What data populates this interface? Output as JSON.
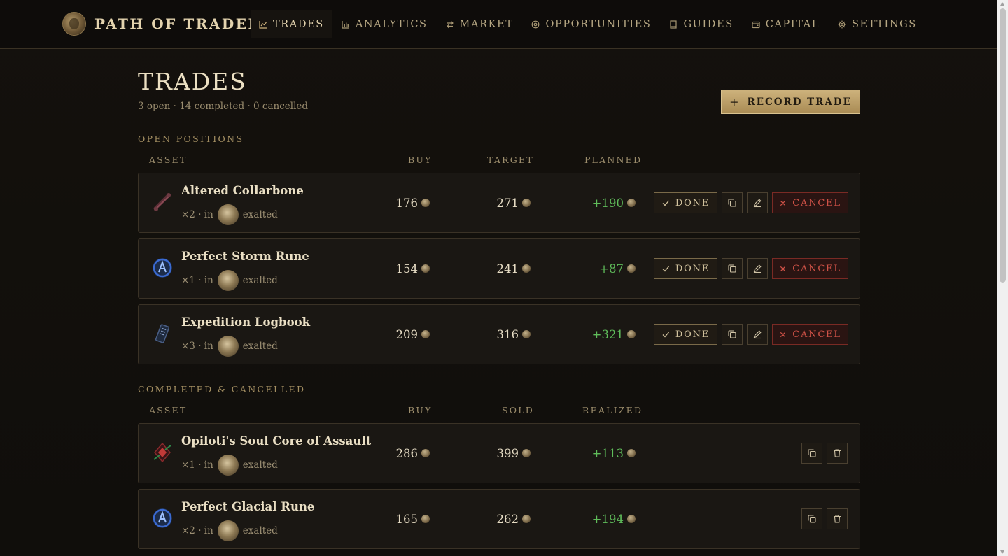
{
  "nav": {
    "brand": "PATH OF TRADER",
    "items": [
      {
        "label": "TRADES",
        "icon": "chart-line-icon",
        "active": true
      },
      {
        "label": "ANALYTICS",
        "icon": "bar-chart-icon"
      },
      {
        "label": "MARKET",
        "icon": "arrows-exchange-icon"
      },
      {
        "label": "OPPORTUNITIES",
        "icon": "target-icon"
      },
      {
        "label": "GUIDES",
        "icon": "book-icon"
      },
      {
        "label": "CAPITAL",
        "icon": "wallet-icon"
      },
      {
        "label": "SETTINGS",
        "icon": "gear-icon"
      }
    ]
  },
  "header": {
    "title": "TRADES",
    "summary": "3 open · 14 completed · 0 cancelled",
    "record_label": "RECORD TRADE",
    "record_icon": "+"
  },
  "open": {
    "section_label": "OPEN POSITIONS",
    "columns": {
      "asset": "ASSET",
      "buy": "BUY",
      "target": "TARGET",
      "planned": "PLANNED"
    },
    "done_label": "DONE",
    "cancel_label": "CANCEL",
    "rows": [
      {
        "name": "Altered Collarbone",
        "qty": "×2 · in",
        "currency": "exalted",
        "buy": "176",
        "target": "271",
        "planned": "+190",
        "icon": "bone-icon"
      },
      {
        "name": "Perfect Storm Rune",
        "qty": "×1 · in",
        "currency": "exalted",
        "buy": "154",
        "target": "241",
        "planned": "+87",
        "icon": "rune-icon"
      },
      {
        "name": "Expedition Logbook",
        "qty": "×3 · in",
        "currency": "exalted",
        "buy": "209",
        "target": "316",
        "planned": "+321",
        "icon": "logbook-icon"
      }
    ]
  },
  "closed": {
    "section_label": "COMPLETED & CANCELLED",
    "columns": {
      "asset": "ASSET",
      "buy": "BUY",
      "sold": "SOLD",
      "realized": "REALIZED"
    },
    "rows": [
      {
        "name": "Opiloti's Soul Core of Assault",
        "qty": "×1 · in",
        "currency": "exalted",
        "buy": "286",
        "sold": "399",
        "realized": "+113",
        "icon": "soul-core-icon"
      },
      {
        "name": "Perfect Glacial Rune",
        "qty": "×2 · in",
        "currency": "exalted",
        "buy": "165",
        "sold": "262",
        "realized": "+194",
        "icon": "rune-icon"
      }
    ]
  },
  "colors": {
    "accent_gold": "#cdb27c",
    "positive": "#5fbc5a",
    "danger": "#d05247",
    "background": "#14110d"
  }
}
